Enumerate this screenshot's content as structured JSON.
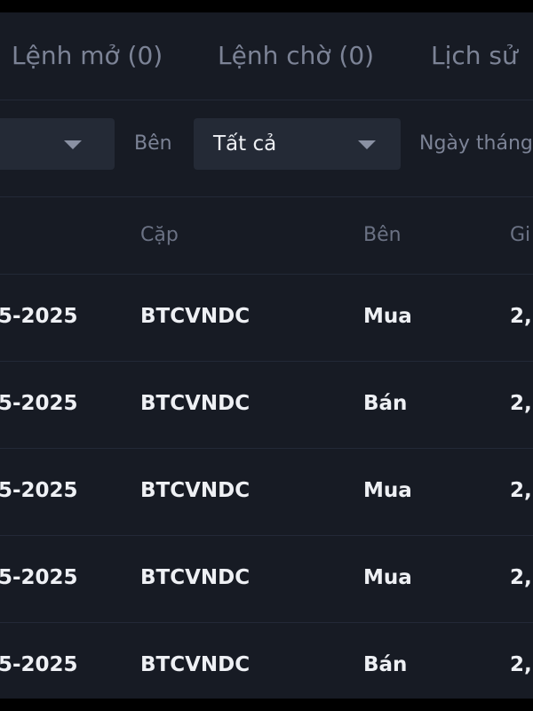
{
  "tabs": [
    {
      "label": "Lệnh mở (0)"
    },
    {
      "label": "Lệnh chờ (0)"
    },
    {
      "label": "Lịch sử"
    }
  ],
  "filters": {
    "first_select_value": "",
    "side_label": "Bên",
    "side_select_value": "Tất cả",
    "date_label": "Ngày tháng"
  },
  "table": {
    "headers": [
      "Cặp",
      "Bên",
      "Gi"
    ],
    "rows": [
      {
        "date": "5-2025",
        "pair": "BTCVNDC",
        "side": "Mua",
        "price": "2,"
      },
      {
        "date": "5-2025",
        "pair": "BTCVNDC",
        "side": "Bán",
        "price": "2,"
      },
      {
        "date": "5-2025",
        "pair": "BTCVNDC",
        "side": "Mua",
        "price": "2,("
      },
      {
        "date": "5-2025",
        "pair": "BTCVNDC",
        "side": "Mua",
        "price": "2,("
      },
      {
        "date": "5-2025",
        "pair": "BTCVNDC",
        "side": "Bán",
        "price": "2,("
      }
    ]
  },
  "colors": {
    "background": "#171b24",
    "select_bg": "#242a36",
    "text_primary": "#eef0f4",
    "text_muted": "#7c8396"
  }
}
